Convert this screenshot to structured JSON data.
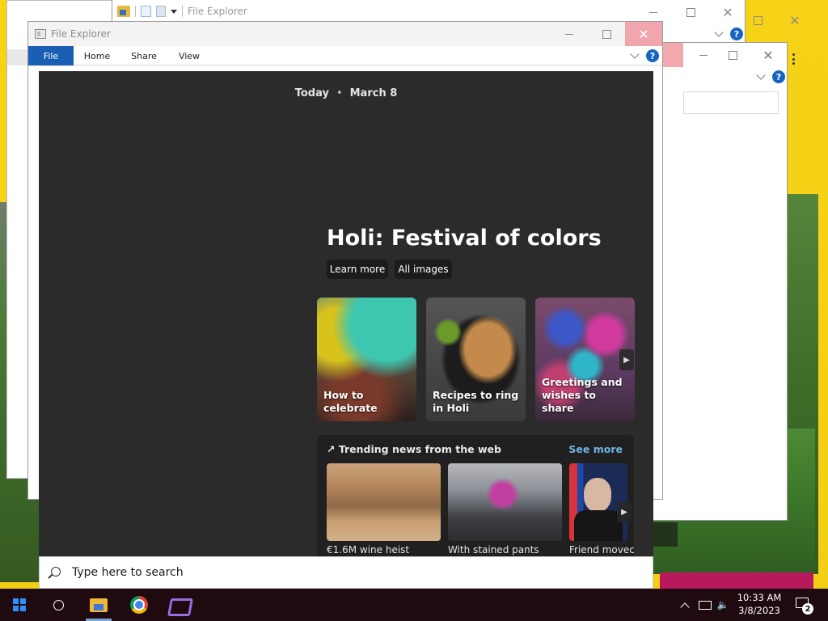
{
  "explorer": {
    "back_window_title": "File Explorer",
    "front_window_title": "File Explorer",
    "ribbon_tabs": [
      "File",
      "Home",
      "Share",
      "View"
    ],
    "help_glyph": "?"
  },
  "highlights": {
    "today_label": "Today",
    "date_label": "March 8",
    "separator": "•",
    "headline": "Holi: Festival of colors",
    "learn_more_label": "Learn more",
    "all_images_label": "All images",
    "cards": [
      {
        "label": "How to celebrate"
      },
      {
        "label": "Recipes to ring in Holi"
      },
      {
        "label": "Greetings and wishes to share"
      }
    ],
    "trending_title": "Trending news from the web",
    "see_more_label": "See more",
    "news": [
      {
        "title": "€1.6M wine heist"
      },
      {
        "title": "With stained pants"
      },
      {
        "title": "Friend movec"
      }
    ]
  },
  "search": {
    "placeholder": "Type here to search"
  },
  "taskbar": {
    "apps": [
      "start-icon",
      "search-icon",
      "file-explorer-icon",
      "chrome-icon",
      "visual-studio-icon"
    ],
    "time": "10:33 AM",
    "date": "3/8/2023",
    "notification_count": "2"
  },
  "colors": {
    "accent": "#1a5fb4",
    "flyout_bg": "#2b2b2b",
    "see_more": "#6bb7e6",
    "taskbar_bg": "#1f0b0f"
  }
}
